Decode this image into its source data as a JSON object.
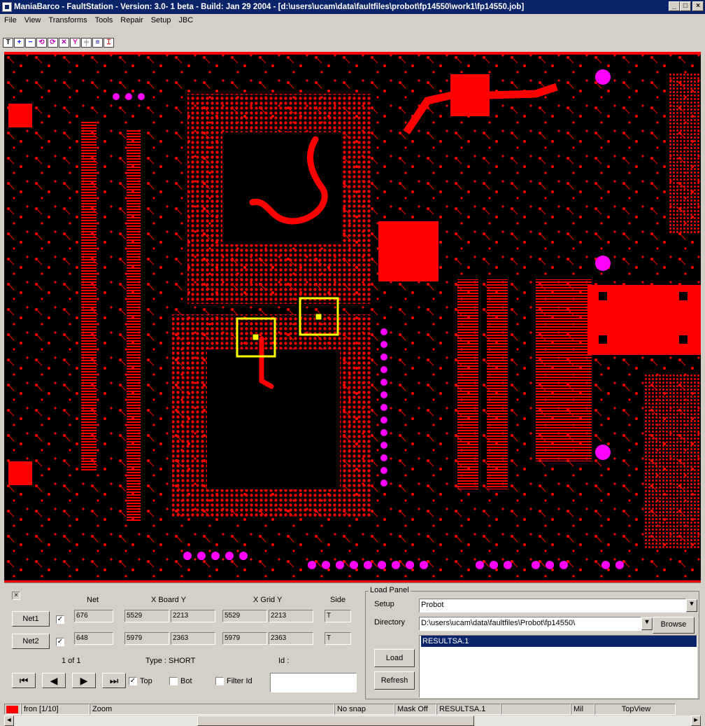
{
  "window": {
    "title": "ManiaBarco - FaultStation - Version: 3.0- 1 beta - Build: Jan 29 2004 - [d:\\users\\ucam\\data\\faultfiles\\probot\\fp14550\\work1\\fp14550.job]",
    "controls": [
      "_",
      "□",
      "×"
    ]
  },
  "menu": [
    "File",
    "View",
    "Transforms",
    "Tools",
    "Repair",
    "Setup",
    "JBC"
  ],
  "toolbar": {
    "tools": [
      {
        "glyph": "T",
        "color": "#000000",
        "icon": "text-tool-icon"
      },
      {
        "glyph": "+",
        "color": "#0000ff",
        "icon": "add-tool-icon"
      },
      {
        "glyph": "−",
        "color": "#0000ff",
        "icon": "minus-tool-icon"
      },
      {
        "glyph": "⟲",
        "color": "#c000c0",
        "icon": "rotate-left-icon"
      },
      {
        "glyph": "⟳",
        "color": "#c000c0",
        "icon": "rotate-right-icon"
      },
      {
        "glyph": "✕",
        "color": "#c000c0",
        "icon": "mirror-x-icon"
      },
      {
        "glyph": "Y",
        "color": "#c000c0",
        "icon": "mirror-y-icon"
      },
      {
        "glyph": "╪",
        "color": "#808080",
        "icon": "grid-icon"
      },
      {
        "glyph": "≡",
        "color": "#000080",
        "icon": "layers-icon"
      },
      {
        "glyph": "⌶",
        "color": "#c00000",
        "icon": "measure-icon"
      }
    ]
  },
  "faults": {
    "close_glyph": "×",
    "headers": {
      "net": "Net",
      "board": "X Board Y",
      "grid": "X Grid Y",
      "side": "Side"
    },
    "rows": [
      {
        "button": "Net1",
        "checked": "✓",
        "net": "676",
        "board_x": "5529",
        "board_y": "2213",
        "grid_x": "5529",
        "grid_y": "2213",
        "side": "T"
      },
      {
        "button": "Net2",
        "checked": "✓",
        "net": "648",
        "board_x": "5979",
        "board_y": "2363",
        "grid_x": "5979",
        "grid_y": "2363",
        "side": "T"
      }
    ],
    "counter": "1 of 1",
    "type": "Type : SHORT",
    "id_label": "Id :",
    "id_value": "",
    "nav": [
      "⏮",
      "◀",
      "▶",
      "⏭"
    ],
    "top": {
      "label": "Top",
      "checked": "✓"
    },
    "bot": {
      "label": "Bot",
      "checked": ""
    },
    "filter": {
      "label": "Filter Id",
      "checked": ""
    }
  },
  "load_panel": {
    "title": "Load Panel",
    "setup_label": "Setup",
    "setup_value": "Probot",
    "directory_label": "Directory",
    "directory_value": "D:\\users\\ucam\\data\\faultfiles\\Probot\\fp14550\\",
    "browse": "Browse",
    "load": "Load",
    "refresh": "Refresh",
    "files": [
      "RESULTSA.1"
    ]
  },
  "status": {
    "layer": "fron [1/10]",
    "layer_color": "#ff0000",
    "mode": "Zoom",
    "snap": "No snap",
    "mask": "Mask Off",
    "file": "RESULTSA.1",
    "units": "Mil",
    "view": "TopView"
  },
  "colors": {
    "copper": "#ff0000",
    "pad_magenta": "#ff00ff",
    "highlight": "#ffff00",
    "titlebar": "#0a246a",
    "selection": "#0a246a"
  }
}
